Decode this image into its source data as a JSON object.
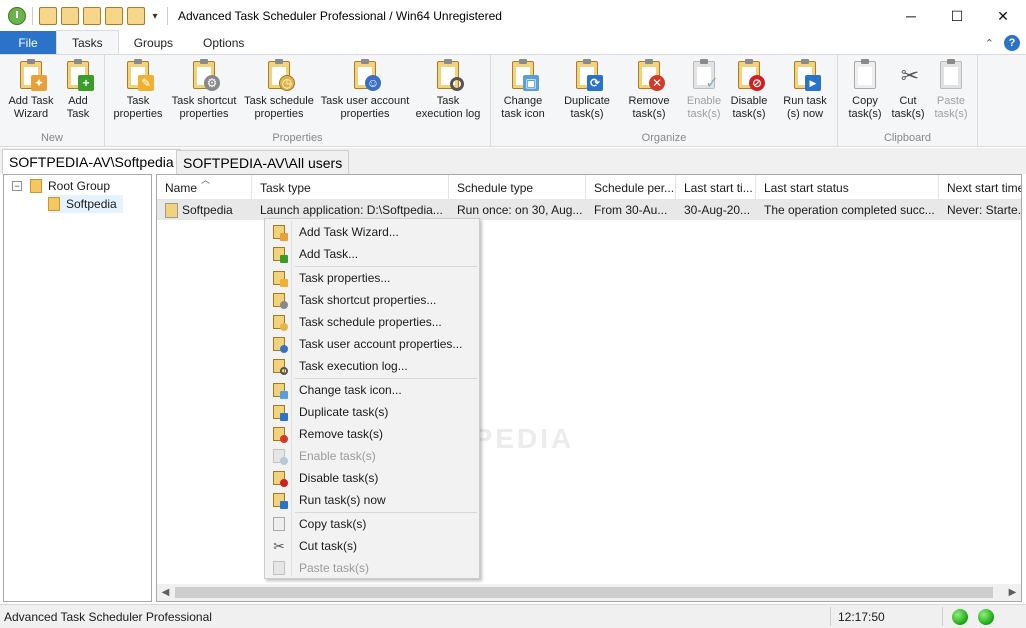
{
  "window": {
    "title": "Advanced Task Scheduler Professional / Win64 Unregistered",
    "controls": {
      "minimize": "─",
      "maximize": "☐",
      "close": "✕"
    }
  },
  "ribbon_tabs": {
    "file": "File",
    "tasks": "Tasks",
    "groups": "Groups",
    "options": "Options"
  },
  "ribbon": {
    "groups": {
      "new": "New",
      "properties": "Properties",
      "organize": "Organize",
      "clipboard": "Clipboard"
    },
    "buttons": {
      "add_wizard": "Add Task\nWizard",
      "add_task": "Add\nTask",
      "task_properties": "Task\nproperties",
      "shortcut_properties": "Task shortcut\nproperties",
      "schedule_properties": "Task schedule\nproperties",
      "user_account_properties": "Task user account\nproperties",
      "execution_log": "Task\nexecution log",
      "change_icon": "Change\ntask icon",
      "duplicate": "Duplicate\ntask(s)",
      "remove": "Remove\ntask(s)",
      "enable": "Enable\ntask(s)",
      "disable": "Disable\ntask(s)",
      "run_now": "Run task\n(s) now",
      "copy": "Copy\ntask(s)",
      "cut": "Cut\ntask(s)",
      "paste": "Paste\ntask(s)"
    }
  },
  "doc_tabs": [
    "SOFTPEDIA-AV\\Softpedia",
    "SOFTPEDIA-AV\\All users"
  ],
  "tree": {
    "root": "Root Group",
    "child": "Softpedia",
    "expander": "−"
  },
  "list": {
    "columns": [
      "Name",
      "Task type",
      "Schedule type",
      "Schedule per...",
      "Last start ti...",
      "Last start status",
      "Next start time"
    ],
    "rows": [
      {
        "name": "Softpedia",
        "task_type": "Launch application: D:\\Softpedia...",
        "schedule_type": "Run once: on 30, Aug...",
        "schedule_period": "From 30-Au...",
        "last_start_time": "30-Aug-20...",
        "last_start_status": "The operation completed succ...",
        "next_start_time": "Never: Starte..."
      }
    ]
  },
  "context_menu": [
    {
      "label": "Add Task Wizard...",
      "enabled": true
    },
    {
      "label": "Add Task...",
      "enabled": true
    },
    {
      "label": "Task properties...",
      "enabled": true
    },
    {
      "label": "Task shortcut properties...",
      "enabled": true
    },
    {
      "label": "Task schedule properties...",
      "enabled": true
    },
    {
      "label": "Task user account properties...",
      "enabled": true
    },
    {
      "label": "Task execution log...",
      "enabled": true
    },
    {
      "label": "Change task icon...",
      "enabled": true
    },
    {
      "label": "Duplicate task(s)",
      "enabled": true
    },
    {
      "label": "Remove task(s)",
      "enabled": true
    },
    {
      "label": "Enable task(s)",
      "enabled": false
    },
    {
      "label": "Disable task(s)",
      "enabled": true
    },
    {
      "label": "Run task(s) now",
      "enabled": true
    },
    {
      "label": "Copy task(s)",
      "enabled": true
    },
    {
      "label": "Cut task(s)",
      "enabled": true
    },
    {
      "label": "Paste task(s)",
      "enabled": false
    }
  ],
  "watermark": "SOFTPEDIA",
  "statusbar": {
    "app_name": "Advanced Task Scheduler Professional",
    "time": "12:17:50"
  },
  "colors": {
    "file_tab": "#2b73c9",
    "status_led": "#18a312"
  }
}
